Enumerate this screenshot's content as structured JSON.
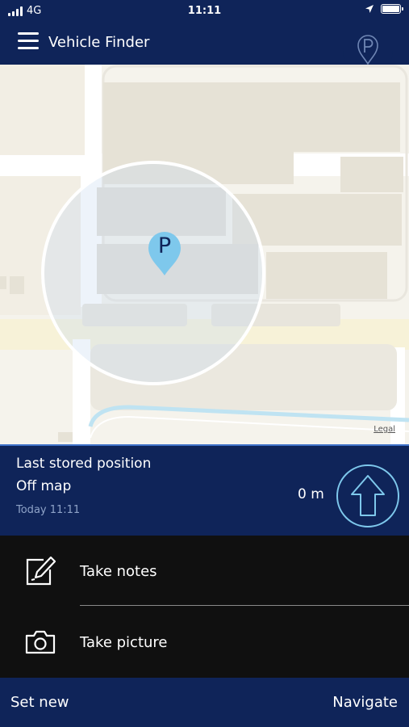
{
  "status_bar": {
    "carrier": "4G",
    "time": "11:11",
    "icons": [
      "signal-icon",
      "location-arrow-icon",
      "battery-icon"
    ]
  },
  "app_bar": {
    "title": "Vehicle Finder",
    "menu_icon": "hamburger-menu-icon",
    "parking_icon": "parking-pin-icon"
  },
  "map": {
    "pin_letter": "P",
    "legal_label": "Legal"
  },
  "position": {
    "title": "Last stored position",
    "subtitle": "Off map",
    "timestamp": "Today 11:11",
    "distance": "0 m",
    "direction_icon": "up-arrow-icon"
  },
  "actions": [
    {
      "label": "Take notes",
      "icon": "edit-note-icon"
    },
    {
      "label": "Take picture",
      "icon": "camera-icon"
    }
  ],
  "bottom_bar": {
    "set_new": "Set new",
    "navigate": "Navigate"
  },
  "colors": {
    "primary": "#0f2459",
    "accent": "#3f71c8",
    "pin": "#7ec8ec",
    "actions_bg": "#101010",
    "map_bg": "#f5f3ec"
  }
}
